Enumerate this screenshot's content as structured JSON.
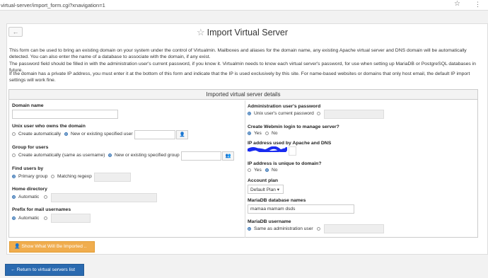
{
  "browser": {
    "url": "virtual-server/import_form.cgi?xnavigation=1",
    "star_glyph": "☆",
    "menu_glyph": "⋮"
  },
  "page": {
    "title": "Import Virtual Server",
    "title_icon_glyph": "☆",
    "back_glyph": "←",
    "paragraphs": [
      "This form can be used to bring an existing domain on your system under the control of Virtualmin. Mailboxes and aliases for the domain name, any existing Apache virtual server and DNS domain will be automatically detected. You can also enter the name of a database to associate with the domain, if any exist.",
      "The password field should be filled in with the administration user's current password, if you know it. Virtualmin needs to know each virtual server's password, for use when setting up MariaDB or PostgreSQL databases in future.",
      "If the domain has a private IP address, you must enter it at the bottom of this form and indicate that the IP is used exclusively by this site. For name-based websites or domains that only host email, the default IP import settings will work fine."
    ]
  },
  "section": {
    "header": "Imported virtual server details",
    "left": {
      "domain_name": {
        "label": "Domain name",
        "value": ""
      },
      "unix_user": {
        "label": "Unix user who owns the domain",
        "opt_auto": "Create automatically",
        "opt_existing": "New or existing specified user",
        "value": "",
        "icon": "👤"
      },
      "group": {
        "label": "Group for users",
        "opt_auto": "Create automatically (same as username)",
        "opt_existing": "New or existing specified group",
        "value": "",
        "icon": "👥"
      },
      "find_users": {
        "label": "Find users by",
        "opt_primary": "Primary group",
        "opt_regexp": "Matching regexp",
        "value": ""
      },
      "home_dir": {
        "label": "Home directory",
        "opt_auto": "Automatic",
        "value": ""
      },
      "mail_prefix": {
        "label": "Prefix for mail usernames",
        "opt_auto": "Automatic",
        "value": ""
      }
    },
    "right": {
      "admin_password": {
        "label": "Administration user's password",
        "opt_current": "Unix user's current password",
        "value": ""
      },
      "webmin_login": {
        "label": "Create Webmin login to manage server?",
        "opt_yes": "Yes",
        "opt_no": "No"
      },
      "ip_address": {
        "label": "IP address used by Apache and DNS",
        "value": "",
        "scribble_color": "#1a2cf0"
      },
      "ip_unique": {
        "label": "IP address is unique to domain?",
        "opt_yes": "Yes",
        "opt_no": "No"
      },
      "account_plan": {
        "label": "Account plan",
        "value": "Default Plan"
      },
      "mariadb_names": {
        "label": "MariaDB database names",
        "value": "mamaa mamam dsds"
      },
      "mariadb_username": {
        "label": "MariaDB username",
        "opt_same": "Same as administration user",
        "value": ""
      }
    }
  },
  "buttons": {
    "show_imported": "Show What Will Be Imported ..",
    "show_icon": "👤",
    "back": "Return to virtual servers list",
    "back_icon": "←"
  },
  "colors": {
    "primary": "#2a6ab0",
    "warning": "#f0ad4e",
    "radio_selected": "#2b6cb0"
  }
}
